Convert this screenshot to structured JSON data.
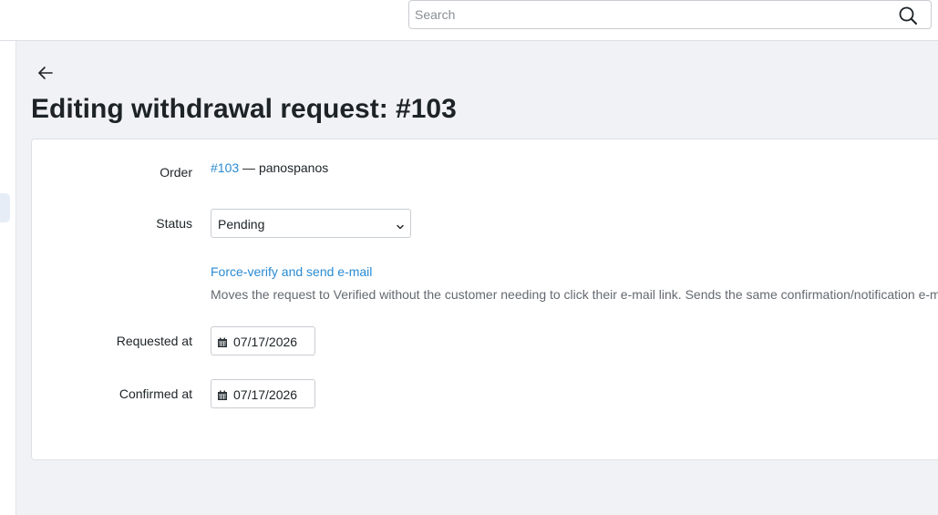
{
  "search": {
    "placeholder": "Search",
    "value": ""
  },
  "page": {
    "title": "Editing withdrawal request: #103"
  },
  "form": {
    "order": {
      "label": "Order",
      "link": "#103",
      "separator": " — ",
      "customer": "panospanos"
    },
    "status": {
      "label": "Status",
      "value": "Pending"
    },
    "force_verify": {
      "link": "Force-verify and send e-mail",
      "help": "Moves the request to Verified without the customer needing to click their e-mail link. Sends the same confirmation/notification e-mail."
    },
    "requested_at": {
      "label": "Requested at",
      "value": "07/17/2026"
    },
    "confirmed_at": {
      "label": "Confirmed at",
      "value": "07/17/2026"
    }
  },
  "icons": {
    "search": "search-icon",
    "back": "arrow-left-icon",
    "chevron": "chevron-down-icon",
    "calendar": "calendar-icon"
  },
  "colors": {
    "link": "#2a8bd3",
    "background": "#f0f2f6",
    "card": "#ffffff"
  }
}
